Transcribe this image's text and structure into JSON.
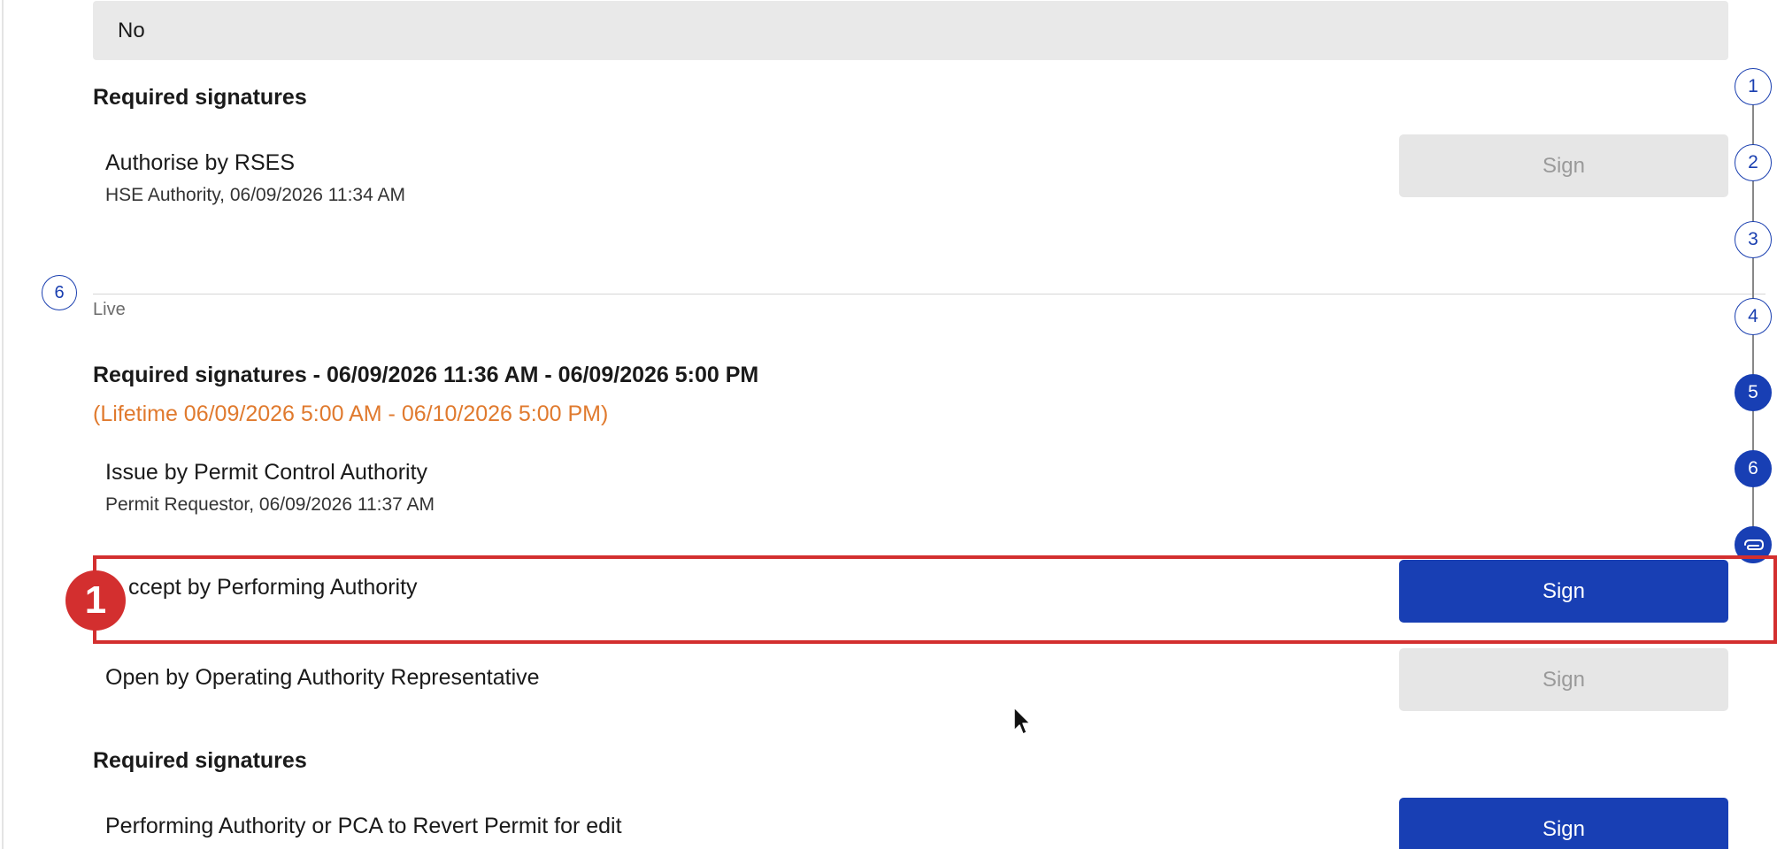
{
  "top_field": {
    "value": "No"
  },
  "section1": {
    "heading": "Required signatures",
    "signature": {
      "title": "Authorise by RSES",
      "subtitle": "HSE Authority, 06/09/2026 11:34 AM",
      "button": "Sign"
    }
  },
  "stage": {
    "number": "6",
    "label": "Live"
  },
  "section2": {
    "heading": "Required signatures - 06/09/2026 11:36 AM - 06/09/2026 5:00 PM",
    "lifetime": "(Lifetime 06/09/2026 5:00 AM - 06/10/2026 5:00 PM)",
    "signatures": [
      {
        "title": "Issue by Permit Control Authority",
        "subtitle": "Permit Requestor, 06/09/2026 11:37 AM"
      },
      {
        "title": "ccept by Performing Authority",
        "button": "Sign"
      },
      {
        "title": "Open by Operating Authority Representative",
        "button": "Sign"
      }
    ]
  },
  "section3": {
    "heading": "Required signatures",
    "signature": {
      "title": "Performing Authority or PCA to Revert Permit for edit",
      "button": "Sign"
    }
  },
  "stepper": {
    "steps": [
      "1",
      "2",
      "3",
      "4",
      "5",
      "6"
    ],
    "attachment_icon": "paperclip-icon"
  },
  "annotation": {
    "badge": "1"
  },
  "colors": {
    "primary": "#183fb4",
    "highlight": "#d32f2f",
    "lifetime": "#e07a2e",
    "disabled": "#e6e6e6"
  }
}
